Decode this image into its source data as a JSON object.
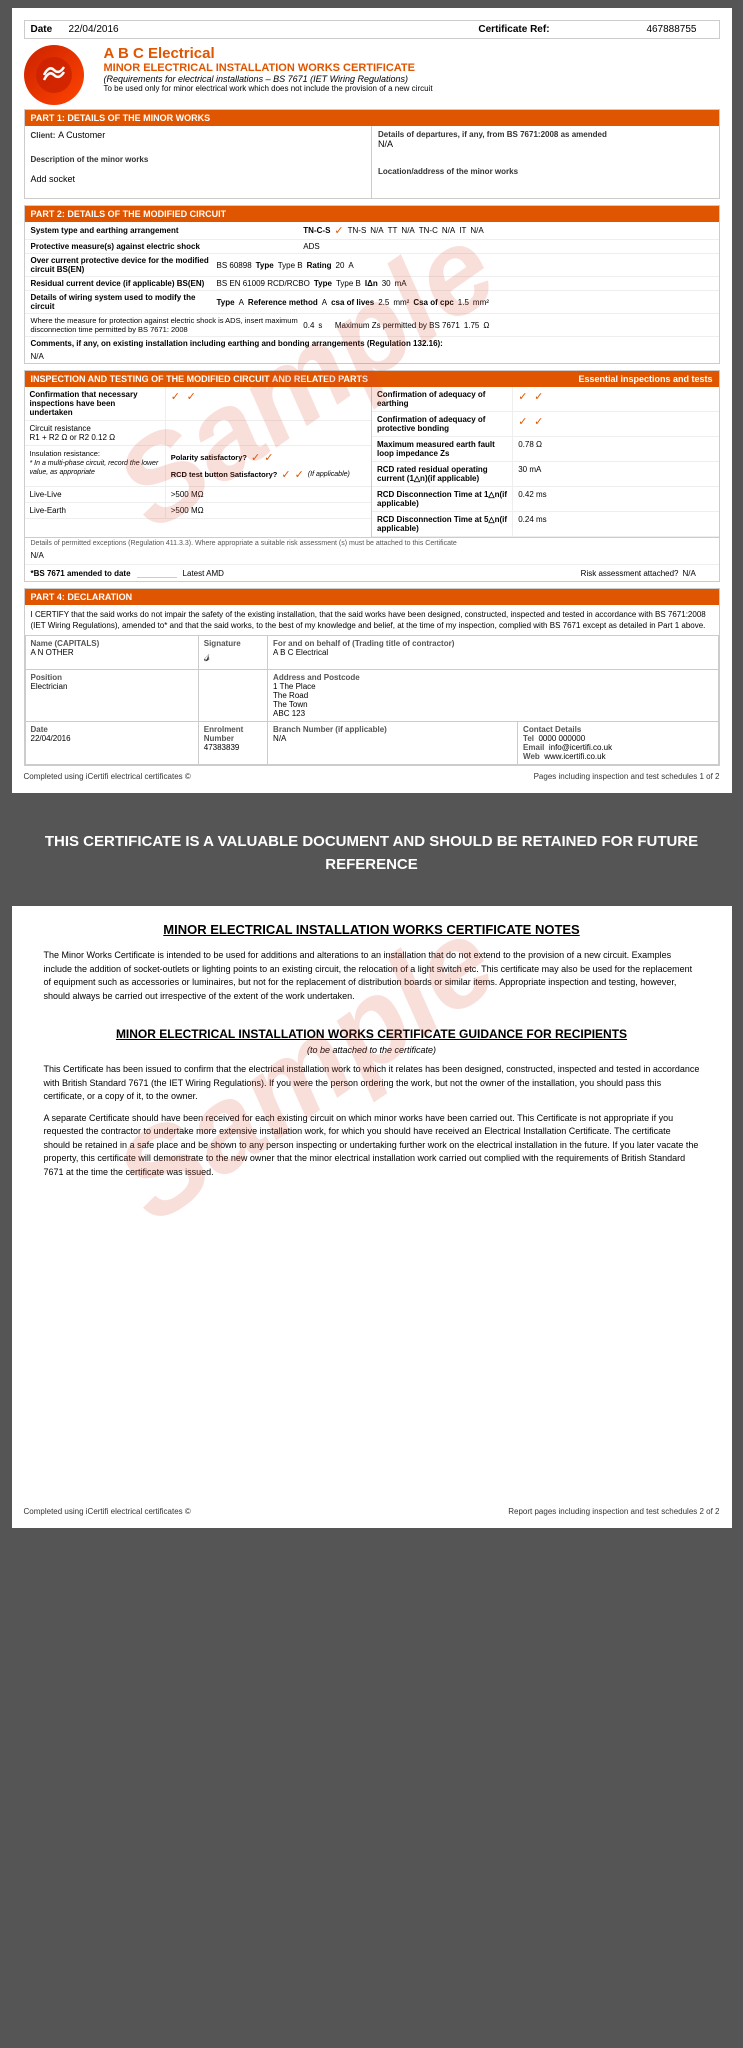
{
  "page1": {
    "date_label": "Date",
    "date_value": "22/04/2016",
    "cert_ref_label": "Certificate Ref:",
    "cert_ref_value": "467888755",
    "company_name": "A B C Electrical",
    "cert_title": "MINOR ELECTRICAL INSTALLATION WORKS CERTIFICATE",
    "cert_requirements": "(Requirements for electrical installations – BS 7671 (IET Wiring Regulations)",
    "cert_note": "To be used only for minor electrical work which does not include the provision of a new circuit",
    "part1_header": "PART 1: DETAILS OF THE MINOR WORKS",
    "departures_label": "Details of departures, if any, from BS 7671:2008 as amended",
    "departures_value": "N/A",
    "client_label": "Client:",
    "client_value": "A Customer",
    "desc_label": "Description of the minor works",
    "desc_value": "Add socket",
    "location_label": "Location/address of the minor works",
    "location_value": "",
    "part2_header": "PART 2: DETAILS OF THE MODIFIED CIRCUIT",
    "system_label": "System type and earthing arrangement",
    "system_tncs": "TN-C-S",
    "system_tns": "TN-S",
    "system_tns_val": "N/A",
    "system_tt": "TT",
    "system_tt_val": "N/A",
    "system_tnc": "TN-C",
    "system_tnc_val": "N/A",
    "system_it": "IT",
    "system_it_val": "N/A",
    "protective_label": "Protective measure(s) against electric shock",
    "protective_value": "ADS",
    "overcurrent_label": "Over current protective device for the modified circuit BS(EN)",
    "overcurrent_bs": "BS 60898",
    "overcurrent_type_label": "Type",
    "overcurrent_type_value": "Type B",
    "overcurrent_rating_label": "Rating",
    "overcurrent_rating_value": "20",
    "overcurrent_unit": "A",
    "rcd_label": "Residual current device (if applicable) BS(EN)",
    "rcd_bs": "BS EN 61009 RCD/RCBO",
    "rcd_type_label": "Type",
    "rcd_type_value": "Type B",
    "rcd_ian_label": "IΔn",
    "rcd_ian_value": "30",
    "rcd_ian_unit": "mA",
    "wiring_label": "Details of wiring system used to modify the circuit",
    "wiring_type_label": "Type",
    "wiring_type_value": "A",
    "wiring_ref_label": "Reference method",
    "wiring_ref_value": "A",
    "wiring_csa_label": "csa of lives",
    "wiring_csa_value": "2.5",
    "wiring_csa_unit": "mm²",
    "wiring_cpc_label": "Csa of cpc",
    "wiring_cpc_value": "1.5",
    "wiring_cpc_unit": "mm²",
    "protection_label": "Where the measure for protection against electric shock is ADS, insert maximum disconnection time permitted by BS 7671: 2008",
    "protection_value": "0.4",
    "protection_unit": "s",
    "max_zs_label": "Maximum Zs permitted by BS 7671",
    "max_zs_value": "1.75",
    "max_zs_unit": "Ω",
    "comments_label": "Comments, if any, on existing installation including earthing and bonding arrangements (Regulation 132.16):",
    "comments_value": "N/A",
    "inspection_header": "INSPECTION AND TESTING OF THE MODIFIED CIRCUIT AND RELATED PARTS",
    "essential_label": "Essential inspections and tests",
    "insp1_label": "Confirmation that necessary inspections have been undertaken",
    "insp1_val1": "✓",
    "insp1_val2": "✓",
    "insp2_label": "Confirmation of adequacy of earthing",
    "insp2_val1": "✓",
    "insp2_val2": "✓",
    "circuit_r_label": "Circuit resistance",
    "circuit_r1r2_label": "R1 + R2",
    "circuit_r1r2_unit": "Ω",
    "circuit_or": "or R2",
    "circuit_r2_value": "0.12",
    "circuit_r2_unit": "Ω",
    "insp3_label": "Confirmation of adequacy of protective bonding",
    "insp3_val1": "✓",
    "insp3_val2": "✓",
    "insulation_label": "Insulation resistance:",
    "insulation_note": "* In a multi-phase circuit, record the lower value, as appropriate",
    "polarity_label": "Polarity satisfactory?",
    "polarity_val1": "✓",
    "polarity_val2": "✓",
    "rcd_test_label": "RCD test button Satisfactory?",
    "rcd_test_val1": "✓",
    "rcd_test_val2": "✓",
    "rcd_test_note": "(If applicable)",
    "max_earth_label": "Maximum measured earth fault loop impedance Zs",
    "max_earth_value": "0.78",
    "max_earth_unit": "Ω",
    "live_live_label": "Live-Live",
    "live_live_value": ">500",
    "live_live_unit": "MΩ",
    "rcd_rated_label": "RCD rated residual operating current (1△n)(if applicable)",
    "rcd_rated_value": "30",
    "rcd_rated_unit": "mA",
    "live_earth_label": "Live-Earth",
    "live_earth_value": ">500",
    "live_earth_unit": "MΩ",
    "rcd_disc1_label": "RCD Disconnection Time at 1△n(if applicable)",
    "rcd_disc1_value": "0.42",
    "rcd_disc1_unit": "ms",
    "rcd_disc2_label": "RCD Disconnection Time at 5△n(if applicable)",
    "rcd_disc2_value": "0.24",
    "rcd_disc2_unit": "ms",
    "details_permitted_label": "Details of permitted exceptions (Regulation 411.3.3). Where appropriate a suitable risk assessment (s) must be attached to this Certificate",
    "details_permitted_value": "N/A",
    "bs7671_label": "*BS 7671 amended to date",
    "bs7671_value": "",
    "amd_label": "Latest AMD",
    "risk_label": "Risk assessment attached?",
    "risk_value": "N/A",
    "part4_header": "PART 4: DECLARATION",
    "decl_text": "I CERTIFY that the said works do not impair the safety of the existing installation, that the said works have been designed, constructed, inspected and tested in accordance with BS 7671:2008 (IET Wiring Regulations), amended to* and that the said works, to the best of my knowledge and belief, at the time of my inspection, complied with BS 7671 except as detailed in Part 1 above.",
    "name_label": "Name (CAPITALS)",
    "name_value": "A N OTHER",
    "behalf_label": "For and on behalf of (Trading title of contractor)",
    "behalf_value": "A B C Electrical",
    "sig_label": "Signature",
    "address_label": "Address and Postcode",
    "address_value": "1 The Place\nThe Road\nThe Town\nABC 123",
    "position_label": "Position",
    "position_value": "Electrician",
    "branch_label": "Branch Number (if applicable)",
    "branch_value": "N/A",
    "date_sig_label": "Date",
    "date_sig_value": "22/04/2016",
    "contact_label": "Contact Details",
    "tel_label": "Tel",
    "tel_value": "0000 000000",
    "email_label": "Email",
    "email_value": "info@icertifi.co.uk",
    "web_label": "Web",
    "web_value": "www.icertifi.co.uk",
    "enrolment_label": "Enrolment Number",
    "enrolment_value": "47383839",
    "footer_left": "Completed using iCertifi electrical certificates ©",
    "footer_right": "Pages including inspection and test schedules 1 of 2"
  },
  "page2": {
    "banner_text": "THIS CERTIFICATE IS A VALUABLE DOCUMENT AND SHOULD BE RETAINED FOR FUTURE REFERENCE",
    "notes_title": "MINOR ELECTRICAL INSTALLATION WORKS CERTIFICATE NOTES",
    "notes_text": "The Minor Works Certificate is intended to be used for additions and alterations to an installation that do not extend to the provision of a new circuit. Examples include the addition of socket-outlets or lighting points to an existing circuit, the relocation of a light switch etc. This certificate may also be used for the replacement of equipment such as accessories or luminaires, but not for the replacement of distribution boards or similar items. Appropriate inspection and testing, however, should always be carried out irrespective of the extent of the work undertaken.",
    "guidance_title": "MINOR ELECTRICAL INSTALLATION WORKS CERTIFICATE GUIDANCE FOR RECIPIENTS",
    "guidance_sub": "(to be attached to the certificate)",
    "guidance_text1": "This Certificate has been issued to confirm that the electrical installation work to which it relates has been designed, constructed, inspected and tested in accordance with British Standard 7671 (the IET Wiring Regulations). If you were the person ordering the work, but not the owner of the installation, you should pass this certificate, or a copy of it, to the owner.",
    "guidance_text2": "A separate Certificate should have been received for each existing circuit on which minor works have been carried out. This Certificate is not appropriate if you requested the contractor to undertake more extensive installation work, for which you should have received an Electrical Installation Certificate. The certificate should be retained in a safe place and be shown to any person inspecting or undertaking further work on the electrical installation in the future. If you later vacate the property, this certificate will demonstrate to the new owner that the minor electrical installation work carried out complied with the requirements of British Standard 7671 at the time the certificate was issued.",
    "footer_left": "Completed using iCertifi electrical certificates ©",
    "footer_right": "Report pages including inspection and test schedules 2 of 2"
  }
}
